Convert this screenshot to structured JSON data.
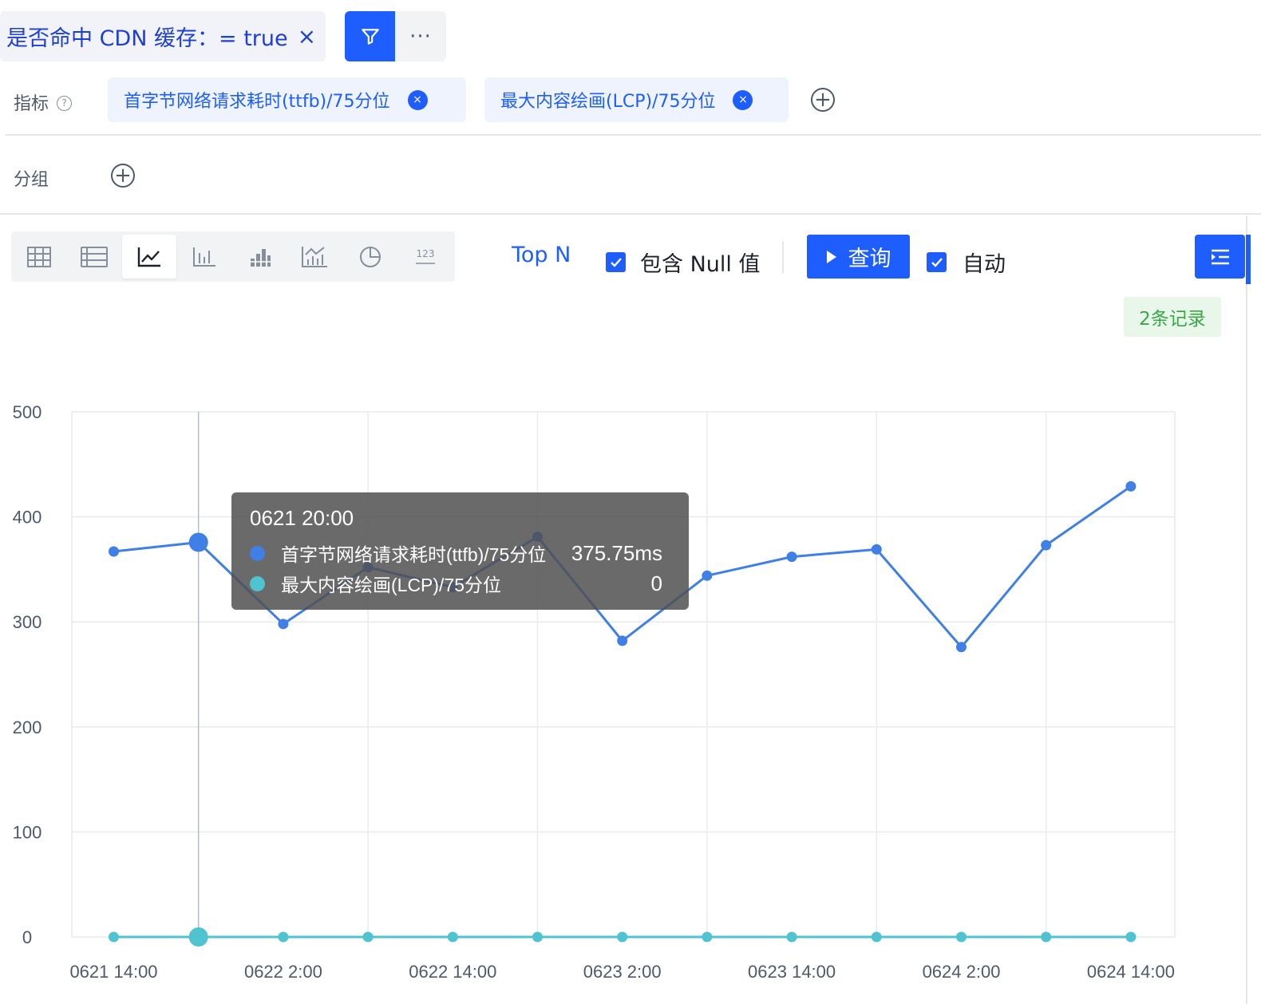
{
  "filter": {
    "label": "是否命中 CDN 缓存：= true",
    "close": "×",
    "more": "···"
  },
  "metrics": {
    "label": "指标",
    "help": "?",
    "tags": [
      {
        "label": "首字节网络请求耗时(ttfb)/75分位",
        "close": "×"
      },
      {
        "label": "最大内容绘画(LCP)/75分位",
        "close": "×"
      }
    ],
    "add": "+"
  },
  "group": {
    "label": "分组",
    "add": "+"
  },
  "toolbar": {
    "viz_types": [
      {
        "icon": "grid-table-icon",
        "active": false
      },
      {
        "icon": "list-table-icon",
        "active": false
      },
      {
        "icon": "line-chart-icon",
        "active": true
      },
      {
        "icon": "bar-chart-icon",
        "active": false
      },
      {
        "icon": "stacked-bar-chart-icon",
        "active": false
      },
      {
        "icon": "combo-chart-icon",
        "active": false
      },
      {
        "icon": "pie-chart-icon",
        "active": false
      },
      {
        "icon": "number-card-icon",
        "active": false
      }
    ],
    "number_icon_text": "123",
    "top_n": "Top N",
    "include_null": {
      "label": "包含 Null 值",
      "checked": true
    },
    "query_label": "查询",
    "auto": {
      "label": "自动",
      "checked": true
    }
  },
  "record_count": "2条记录",
  "colors": {
    "accent": "#1e5eff",
    "series_ttfb": "#3f7fe6",
    "series_lcp": "#4fc3cf"
  },
  "chart_data": {
    "type": "line",
    "x": [
      "0621 14:00",
      "0621 20:00",
      "0622 2:00",
      "0622 8:00",
      "0622 14:00",
      "0622 20:00",
      "0623 2:00",
      "0623 8:00",
      "0623 14:00",
      "0623 20:00",
      "0624 2:00",
      "0624 8:00",
      "0624 14:00"
    ],
    "x_tick_labels": [
      "0621 14:00",
      "0622 2:00",
      "0622 14:00",
      "0623 2:00",
      "0623 14:00",
      "0624 2:00",
      "0624 14:00"
    ],
    "y_ticks": [
      "0",
      "100",
      "200",
      "300",
      "400",
      "500"
    ],
    "ylim": [
      0,
      500
    ],
    "grid": true,
    "series": [
      {
        "name": "首字节网络请求耗时(ttfb)/75分位",
        "values": [
          367,
          375.75,
          298,
          352,
          333,
          381,
          282,
          344,
          362,
          369,
          276,
          373,
          429
        ]
      },
      {
        "name": "最大内容绘画(LCP)/75分位",
        "values": [
          0,
          0,
          0,
          0,
          0,
          0,
          0,
          0,
          0,
          0,
          0,
          0,
          0
        ]
      }
    ],
    "hover_index": 1,
    "tooltip": {
      "title": "0621 20:00",
      "rows": [
        {
          "name": "首字节网络请求耗时(ttfb)/75分位",
          "value": "375.75ms"
        },
        {
          "name": "最大内容绘画(LCP)/75分位",
          "value": "0"
        }
      ]
    }
  }
}
